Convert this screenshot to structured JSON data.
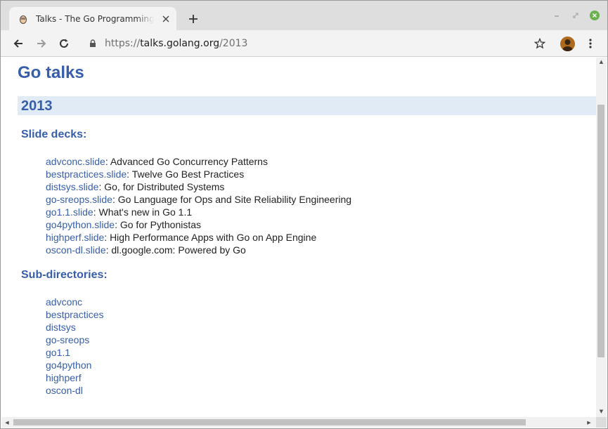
{
  "browser": {
    "tab_title": "Talks - The Go Programming Language",
    "close_glyph": "✕",
    "newtab_glyph": "+",
    "url": {
      "scheme": "https://",
      "host": "talks.golang.org",
      "path": "/2013"
    }
  },
  "page": {
    "title": "Go talks",
    "year": "2013",
    "slide_decks_heading": "Slide decks:",
    "slide_decks": [
      {
        "link": "advconc.slide",
        "sep": ": ",
        "desc": "Advanced Go Concurrency Patterns"
      },
      {
        "link": "bestpractices.slide",
        "sep": ": ",
        "desc": "Twelve Go Best Practices"
      },
      {
        "link": "distsys.slide",
        "sep": ": ",
        "desc": "Go, for Distributed Systems"
      },
      {
        "link": "go-sreops.slide",
        "sep": ": ",
        "desc": "Go Language for Ops and Site Reliability Engineering"
      },
      {
        "link": "go1.1.slide",
        "sep": ": ",
        "desc": "What's new in Go 1.1"
      },
      {
        "link": "go4python.slide",
        "sep": ": ",
        "desc": "Go for Pythonistas"
      },
      {
        "link": "highperf.slide",
        "sep": ": ",
        "desc": "High Performance Apps with Go on App Engine"
      },
      {
        "link": "oscon-dl.slide",
        "sep": ": ",
        "desc": "dl.google.com: Powered by Go"
      }
    ],
    "subdirs_heading": "Sub-directories:",
    "subdirs": [
      "advconc",
      "bestpractices",
      "distsys",
      "go-sreops",
      "go1.1",
      "go4python",
      "highperf",
      "oscon-dl"
    ]
  },
  "icons": {
    "favicon": "gopher-favicon-icon",
    "back": "arrow-left-icon",
    "forward": "arrow-right-icon",
    "reload": "reload-icon",
    "lock": "lock-icon",
    "bookmark": "star-icon",
    "menu": "kebab-menu-icon"
  },
  "colors": {
    "link": "#375eab",
    "heading_bar": "#e0ebf5",
    "tabstrip": "#dedede",
    "toolbar": "#f3f3f3",
    "window_close": "#6ab04c"
  }
}
